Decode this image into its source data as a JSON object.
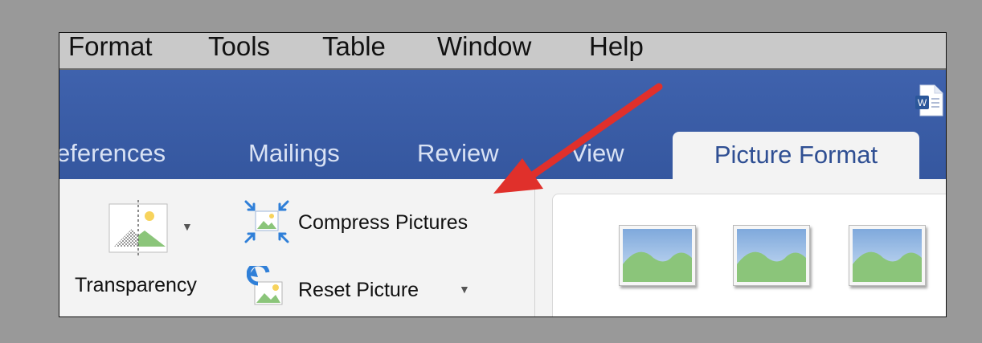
{
  "menu_bar": {
    "items": [
      "Format",
      "Tools",
      "Table",
      "Window",
      "Help"
    ]
  },
  "ribbon": {
    "tabs": [
      "eferences",
      "Mailings",
      "Review",
      "View"
    ],
    "active_tab": "Picture Format"
  },
  "adjust": {
    "transparency_label": "Transparency",
    "compress_label": "Compress Pictures",
    "reset_label": "Reset Picture"
  },
  "picture_styles": {
    "thumbnail_count": 3
  },
  "colors": {
    "ribbon_blue": "#3a5ca6",
    "arrow_red": "#e0302b",
    "icon_blue": "#2f7fd8",
    "landscape_green": "#8bc57a",
    "sky_blue": "#9cc1ea"
  },
  "icons": [
    "word-document-icon",
    "transparency-icon",
    "compress-pictures-icon",
    "reset-picture-icon"
  ]
}
